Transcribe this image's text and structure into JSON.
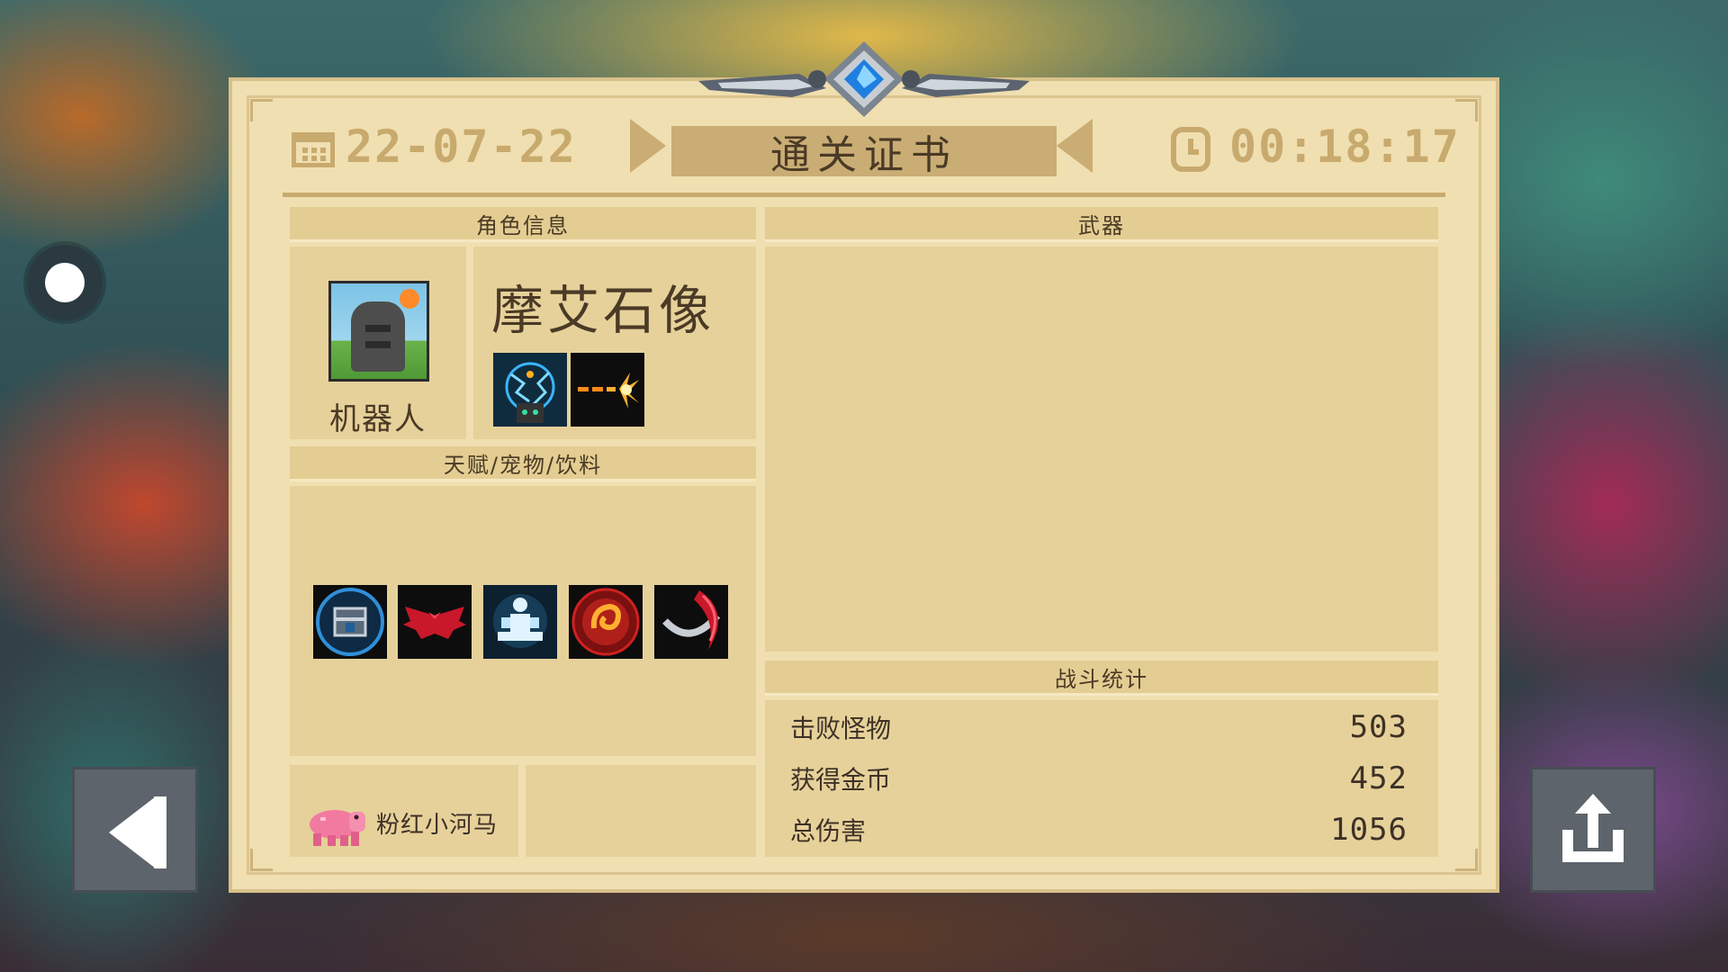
{
  "certificate": {
    "title": "通关证书",
    "date": "22-07-22",
    "time": "00:18:17"
  },
  "character": {
    "section_label": "角色信息",
    "class_name": "机器人",
    "skin_name": "摩艾石像",
    "portrait_icon": "moai-statue-portrait-icon",
    "skill_icons": [
      "electric-orb-skill-icon",
      "laser-shot-skill-icon"
    ]
  },
  "talents": {
    "section_label": "天赋/宠物/饮料",
    "icons": [
      "chest-two-icon",
      "red-bat-wings-icon",
      "meditating-figure-icon",
      "fire-spiral-icon",
      "curved-blade-icon"
    ]
  },
  "pet": {
    "name": "粉红小河马",
    "icon": "pink-hippo-pet-icon"
  },
  "weapons": {
    "section_label": "武器"
  },
  "battle_stats": {
    "section_label": "战斗统计",
    "rows": [
      {
        "label": "击败怪物",
        "value": "503"
      },
      {
        "label": "获得金币",
        "value": "452"
      },
      {
        "label": "总伤害",
        "value": "1056"
      }
    ]
  },
  "controls": {
    "record_icon": "record-icon",
    "back_icon": "back-arrow-icon",
    "share_icon": "share-icon"
  },
  "colors": {
    "paper": "#f0dfb0",
    "panel": "#e6d19a",
    "header_gold": "#c8aa6e",
    "text_dark": "#4a3a26"
  }
}
